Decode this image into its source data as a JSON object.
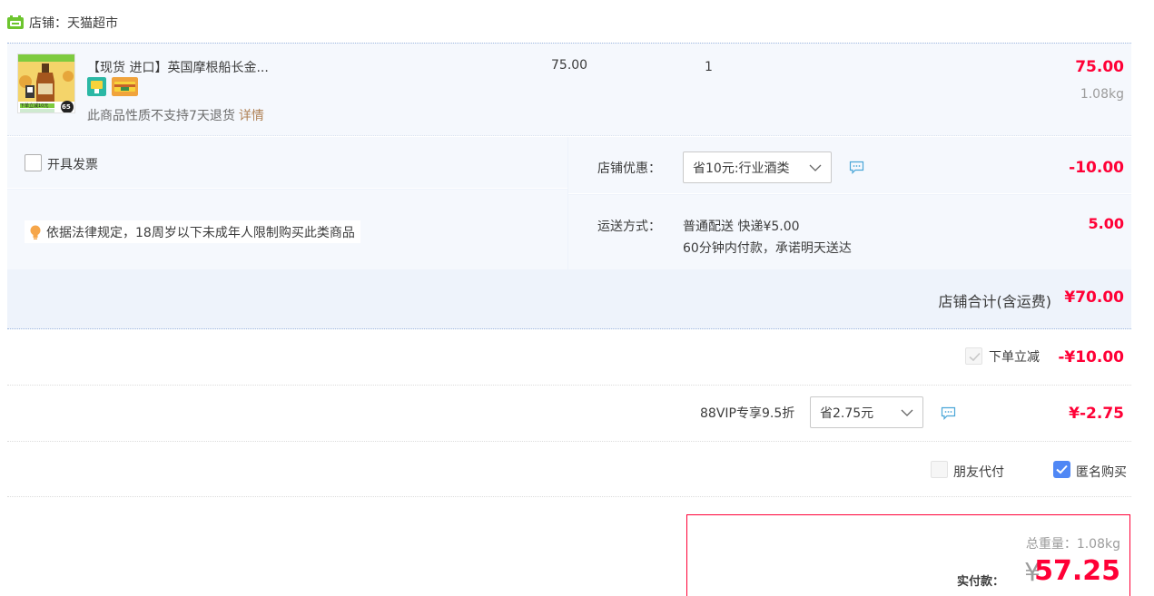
{
  "shop": {
    "label": "店铺：",
    "name": "天猫超市",
    "icon": "tmall-supermarket-icon"
  },
  "item": {
    "title": "【现货 进口】英国摩根船长金...",
    "unit_price": "75.00",
    "quantity": "1",
    "subtotal": "75.00",
    "weight": "1.08kg",
    "note": "此商品性质不支持7天退货",
    "note_link": "详情",
    "thumb_banner": "下单立减10元",
    "thumb_price": "65"
  },
  "invoice": {
    "label": "开具发票"
  },
  "law_notice": "依据法律规定，18周岁以下未成年人限制购买此类商品",
  "shop_discount": {
    "label": "店铺优惠：",
    "selected": "省10元:行业酒类",
    "amount": "-10.00"
  },
  "shipping": {
    "label": "运送方式：",
    "method": "普通配送 快递¥5.00",
    "promise": "60分钟内付款，承诺明天送达",
    "amount": "5.00"
  },
  "shop_total": {
    "label": "店铺合计(含运费)",
    "value": "¥70.00"
  },
  "order_discount": {
    "label": "下单立减",
    "value": "-¥10.00",
    "checked": true
  },
  "vip": {
    "label": "88VIP专享9.5折",
    "selected": "省2.75元",
    "value": "¥-2.75"
  },
  "pay_options": {
    "friend_pay": "朋友代付",
    "anonymous": "匿名购买",
    "anonymous_checked": true
  },
  "final": {
    "weight_label": "总重量：",
    "weight": "1.08kg",
    "pay_label": "实付款：",
    "currency": "¥",
    "amount": "57.25"
  },
  "colors": {
    "accent_red": "#ff0036",
    "row_bg": "#f5f8fd",
    "checkbox_blue": "#4f87f5",
    "link_brown": "#b08257"
  }
}
